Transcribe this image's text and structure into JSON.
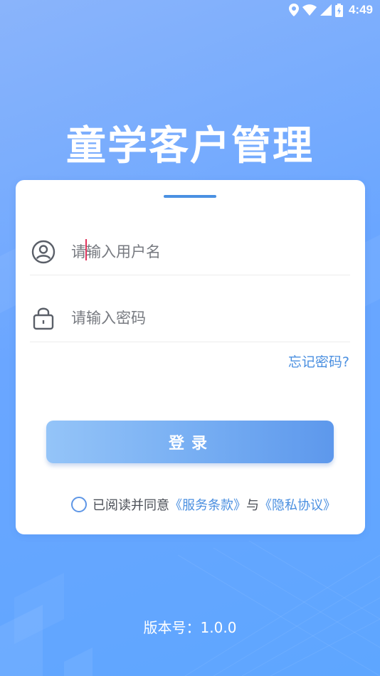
{
  "status_bar": {
    "time": "4:49",
    "icons": [
      "location-icon",
      "wifi-icon",
      "signal-icon",
      "battery-icon"
    ]
  },
  "app": {
    "title": "童学客户管理"
  },
  "login_form": {
    "username_placeholder": "请输入用户名",
    "password_placeholder": "请输入密码",
    "forgot_password": "忘记密码?",
    "login_button": "登录"
  },
  "agreement": {
    "prefix": "已阅读并同意",
    "terms_link": "《服务条款》",
    "joiner": "与",
    "privacy_link": "《隐私协议》",
    "checked": false
  },
  "footer": {
    "version": "版本号：1.0.0"
  },
  "colors": {
    "background_start": "#8ab4fb",
    "background_end": "#5ea6ff",
    "accent": "#4a8fe0",
    "button_start": "#94c4f8",
    "button_end": "#5d98ec"
  }
}
